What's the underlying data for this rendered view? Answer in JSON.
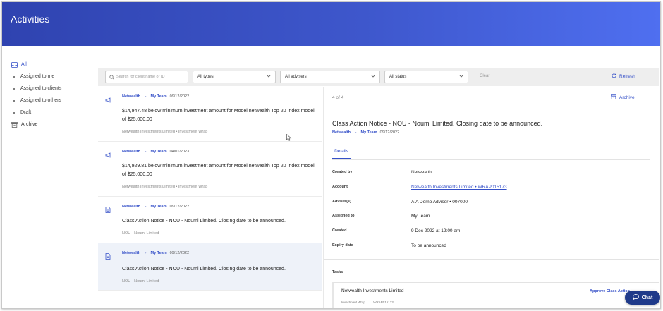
{
  "header": {
    "title": "Activities"
  },
  "sidebar": {
    "items": [
      {
        "label": "All",
        "icon": "inbox-icon",
        "active": true
      },
      {
        "label": "Assigned to me"
      },
      {
        "label": "Assigned to clients"
      },
      {
        "label": "Assigned to others"
      },
      {
        "label": "Draft"
      },
      {
        "label": "Archive",
        "icon": "archive-icon"
      }
    ]
  },
  "filters": {
    "search_placeholder": "Search for client name or ID",
    "types_label": "All types",
    "advisers_label": "All advisers",
    "status_label": "All status",
    "clear_label": "Clear",
    "refresh_label": "Refresh"
  },
  "activities": [
    {
      "source": "Netwealth",
      "team": "My Team",
      "date": "09/12/2022",
      "text": "$14,947.48 below minimum investment amount for Model netwealth Top 20 Index model of $25,000.00",
      "sub": "Netwealth Investments Limited • Investment Wrap",
      "icon": "megaphone-icon"
    },
    {
      "source": "Netwealth",
      "team": "My Team",
      "date": "04/01/2023",
      "text": "$14,929.81 below minimum investment amount for Model netwealth Top 20 Index model of $25,000.00",
      "sub": "Netwealth Investments Limited • Investment Wrap",
      "icon": "megaphone-icon"
    },
    {
      "source": "Netwealth",
      "team": "My Team",
      "date": "09/12/2022",
      "text": "Class Action Notice - NOU - Noumi Limited. Closing date to be announced.",
      "sub": "NOU - Noumi Limited",
      "icon": "document-icon"
    },
    {
      "source": "Netwealth",
      "team": "My Team",
      "date": "09/12/2022",
      "text": "Class Action Notice - NOU - Noumi Limited. Closing date to be announced.",
      "sub": "NOU - Noumi Limited",
      "icon": "document-icon",
      "selected": true
    }
  ],
  "detail": {
    "count": "4 of 4",
    "archive_label": "Archive",
    "title": "Class Action Notice - NOU - Noumi Limited. Closing date to be announced.",
    "source": "Netwealth",
    "team": "My Team",
    "date": "09/12/2022",
    "tab": "Details",
    "fields": {
      "created_by": {
        "label": "Created by",
        "value": "Netwealth"
      },
      "account": {
        "label": "Account",
        "value": "Netwealth Investments Limited • WRAP015173"
      },
      "advisers": {
        "label": "Adviser(s)",
        "value": "AIA Demo Adviser • 007000"
      },
      "assigned_to": {
        "label": "Assigned to",
        "value": "My Team"
      },
      "created": {
        "label": "Created",
        "value": "9 Dec 2022 at 12:00 am"
      },
      "expiry": {
        "label": "Expiry date",
        "value": "To be announced"
      }
    },
    "tasks_label": "Tasks",
    "task": {
      "name": "Netwealth Investments Limited",
      "product": "Investment Wrap",
      "account": "WRAP015173",
      "action": "Approve Class Action"
    }
  },
  "chat": {
    "label": "Chat"
  },
  "colors": {
    "brand": "#3550c8",
    "header_start": "#2f43b0",
    "header_end": "#4f6ff0",
    "chat": "#1f3a8a"
  }
}
